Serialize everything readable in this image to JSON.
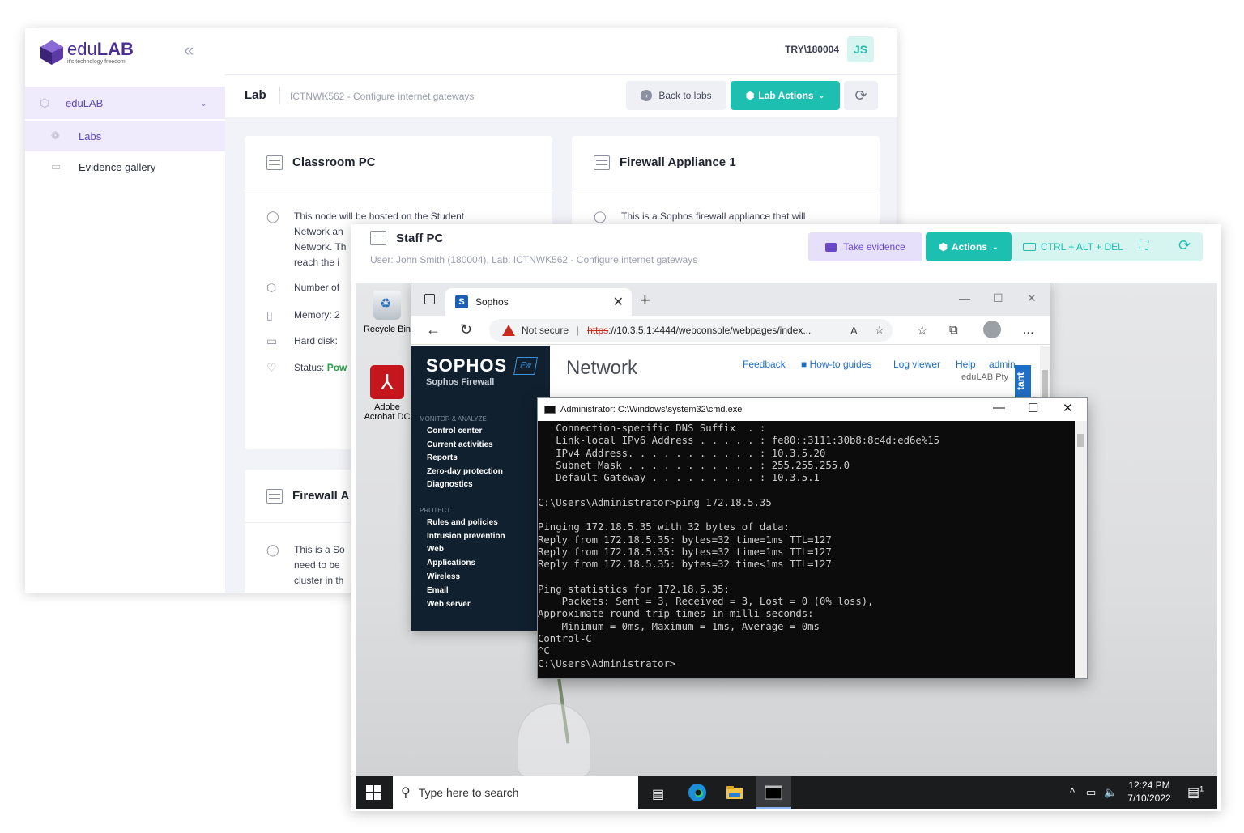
{
  "portal": {
    "logo": {
      "name_light": "edu",
      "name_bold": "LAB",
      "tagline": "it's technology freedom"
    },
    "collapse_icon": "double-chevron-left-icon",
    "nav": {
      "group_label": "eduLAB",
      "items": [
        {
          "label": "Labs",
          "icon": "labs-icon"
        },
        {
          "label": "Evidence gallery",
          "icon": "gallery-icon"
        }
      ]
    },
    "user": {
      "id": "TRY\\180004",
      "initials": "JS"
    },
    "labbar": {
      "label": "Lab",
      "course": "ICTNWK562 - Configure internet gateways",
      "back_label": "Back to labs",
      "actions_label": "Lab Actions"
    },
    "cards": [
      {
        "title": "Classroom PC",
        "description": "This node will be hosted on the Student Network an Network. Th reach the i",
        "description_lines": [
          "This node will be hosted on the Student",
          "Network an",
          "Network. Th",
          "reach the i"
        ],
        "number_label": "Number of",
        "memory_label": "Memory: 2",
        "disk_label": "Hard disk:",
        "status_label": "Status:",
        "status_value": "Pow"
      },
      {
        "title": "Firewall Appliance 1",
        "description_lines": [
          "This is a Sophos firewall appliance that will"
        ]
      },
      {
        "title": "Firewall A",
        "description_lines": [
          "This is a So",
          "need to be",
          "cluster in th"
        ]
      }
    ]
  },
  "staff": {
    "title": "Staff PC",
    "subtitle": "User: John Smith (180004), Lab: ICTNWK562 - Configure internet gateways",
    "take_evidence_label": "Take evidence",
    "actions_label": "Actions",
    "cad_label": "CTRL + ALT + DEL"
  },
  "desktop": {
    "icons": [
      {
        "label": "Recycle Bin"
      },
      {
        "label_line1": "Adobe",
        "label_line2": "Acrobat DC"
      }
    ]
  },
  "browser": {
    "tab_title": "Sophos",
    "not_secure": "Not secure",
    "url_scheme": "https",
    "url_rest": "://10.3.5.1:4444/webconsole/webpages/index...",
    "sophos": {
      "logo": "SOPHOS",
      "badge": "Fw",
      "subtitle": "Sophos Firewall",
      "section_monitor": "MONITOR & ANALYZE",
      "monitor_items": [
        "Control center",
        "Current activities",
        "Reports",
        "Zero-day protection",
        "Diagnostics"
      ],
      "section_protect": "PROTECT",
      "protect_items": [
        "Rules and policies",
        "Intrusion prevention",
        "Web",
        "Applications",
        "Wireless",
        "Email",
        "Web server"
      ],
      "page_title": "Network",
      "links": [
        "Feedback",
        "How-to guides",
        "Log viewer",
        "Help",
        "admin"
      ],
      "company": "eduLAB Pty",
      "assistant": "tant"
    }
  },
  "cmd": {
    "title": "Administrator: C:\\Windows\\system32\\cmd.exe",
    "lines": [
      "   Connection-specific DNS Suffix  . :",
      "   Link-local IPv6 Address . . . . . : fe80::3111:30b8:8c4d:ed6e%15",
      "   IPv4 Address. . . . . . . . . . . : 10.3.5.20",
      "   Subnet Mask . . . . . . . . . . . : 255.255.255.0",
      "   Default Gateway . . . . . . . . . : 10.3.5.1",
      "",
      "C:\\Users\\Administrator>ping 172.18.5.35",
      "",
      "Pinging 172.18.5.35 with 32 bytes of data:",
      "Reply from 172.18.5.35: bytes=32 time=1ms TTL=127",
      "Reply from 172.18.5.35: bytes=32 time=1ms TTL=127",
      "Reply from 172.18.5.35: bytes=32 time<1ms TTL=127",
      "",
      "Ping statistics for 172.18.5.35:",
      "    Packets: Sent = 3, Received = 3, Lost = 0 (0% loss),",
      "Approximate round trip times in milli-seconds:",
      "    Minimum = 0ms, Maximum = 1ms, Average = 0ms",
      "Control-C",
      "^C",
      "C:\\Users\\Administrator>"
    ]
  },
  "taskbar": {
    "search_placeholder": "Type here to search",
    "time": "12:24 PM",
    "date": "7/10/2022",
    "notification_count": "1"
  },
  "colors": {
    "accent_teal": "#1dbfb0",
    "accent_purple": "#5a4bb5",
    "status_green": "#24a148",
    "sophos_dark": "#11202f"
  }
}
